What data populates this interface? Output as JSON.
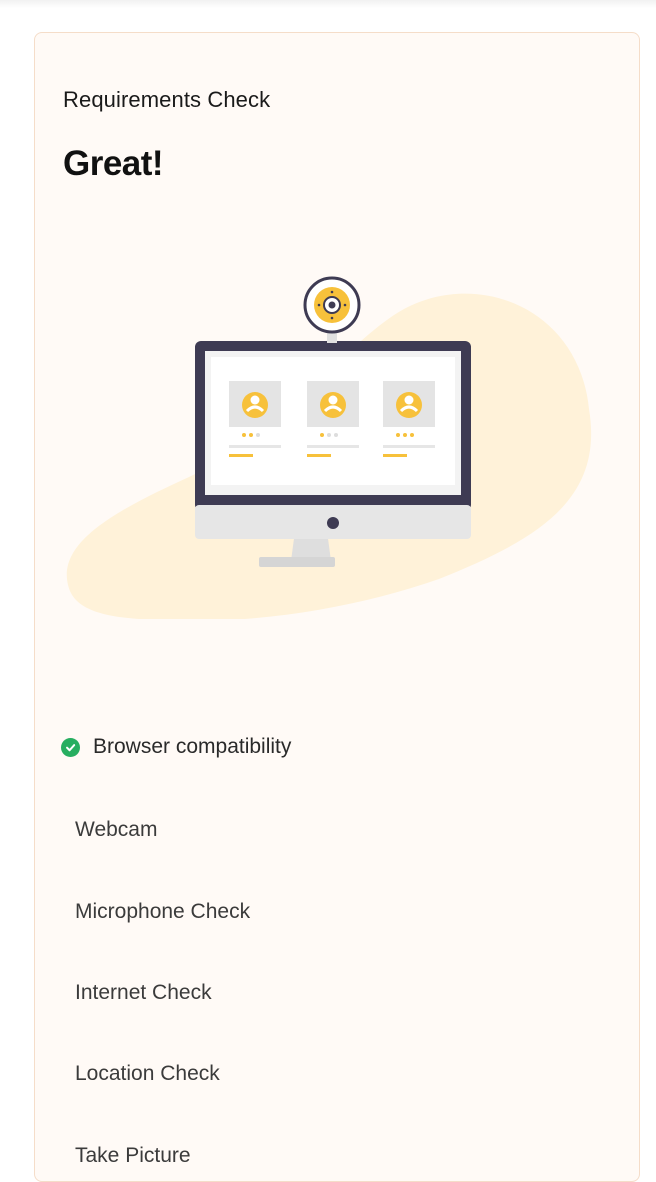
{
  "card": {
    "subtitle": "Requirements Check",
    "title": "Great!"
  },
  "illustration": {
    "name": "computer-with-webcam-illustration",
    "colors": {
      "blob": "#fff2d9",
      "monitor_frame": "#3e3b53",
      "accent": "#f7c13b"
    }
  },
  "checks": [
    {
      "label": "Browser compatibility",
      "status": "passed",
      "icon": "check-circle-icon",
      "color": "#27ae60"
    },
    {
      "label": "Webcam",
      "status": "pending"
    },
    {
      "label": "Microphone Check",
      "status": "pending"
    },
    {
      "label": "Internet Check",
      "status": "pending"
    },
    {
      "label": "Location Check",
      "status": "pending"
    },
    {
      "label": "Take Picture",
      "status": "pending"
    }
  ]
}
